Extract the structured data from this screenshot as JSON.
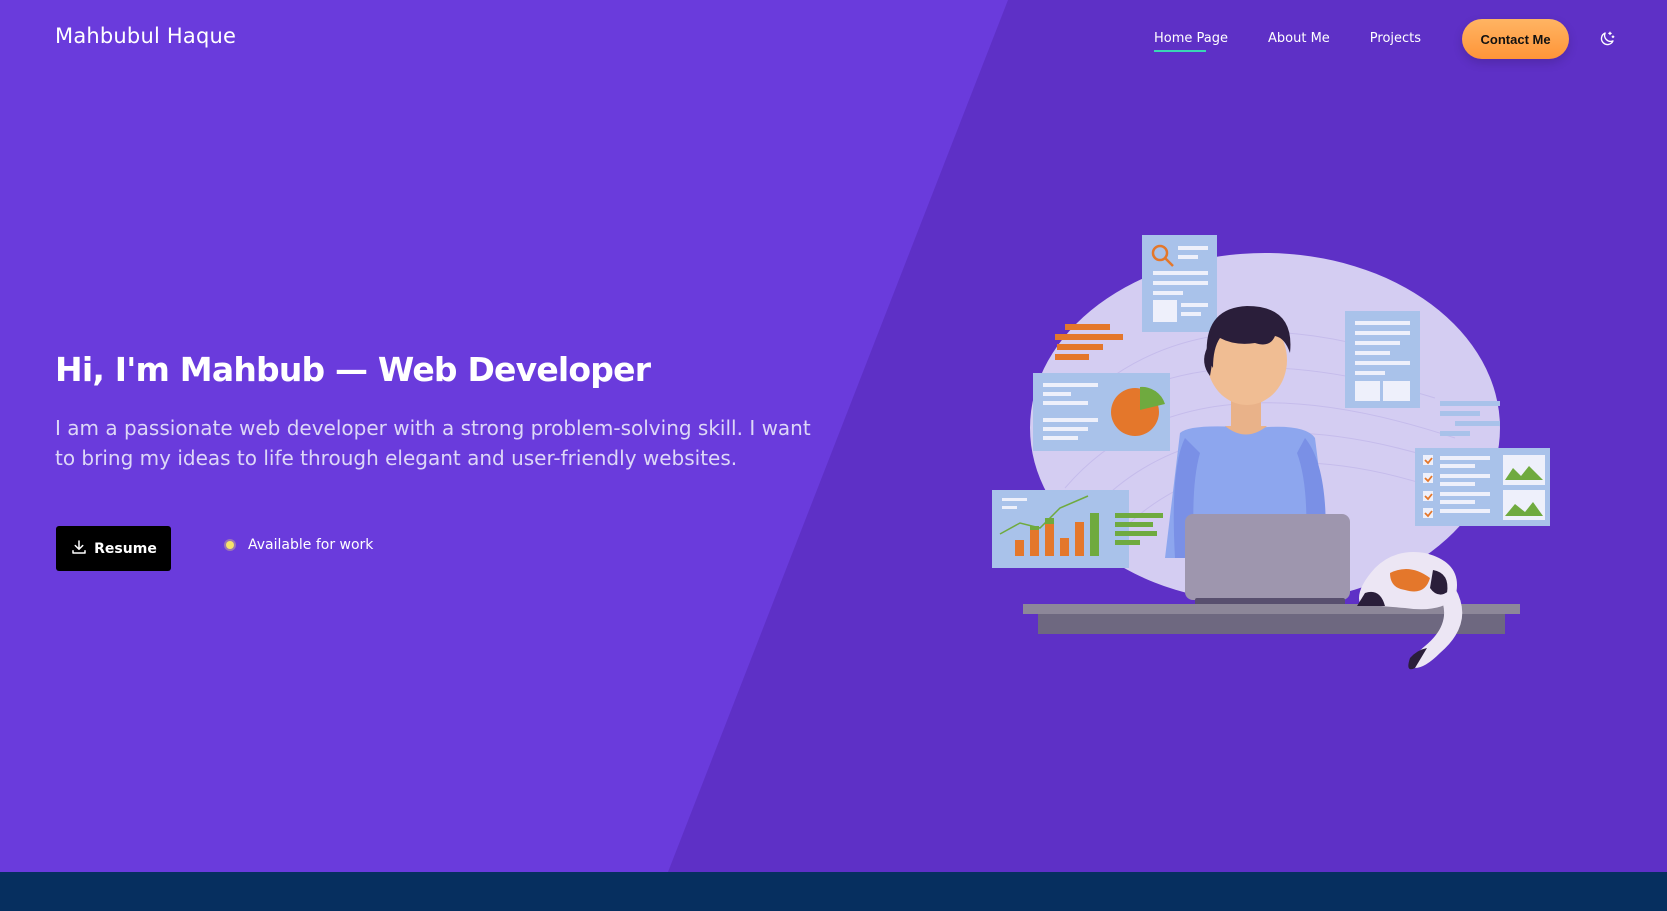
{
  "header": {
    "logo": "Mahbubul Haque",
    "nav": [
      {
        "label": "Home Page",
        "active": true
      },
      {
        "label": "About Me",
        "active": false
      },
      {
        "label": "Projects",
        "active": false
      }
    ],
    "contact_label": "Contact Me",
    "theme_icon": "moon-stars-icon"
  },
  "hero": {
    "headline": "Hi, I'm Mahbub — Web Developer",
    "intro": "I am a passionate web developer with a strong problem-solving skill. I want to bring my ideas to life through elegant and user-friendly websites.",
    "resume_label": "Resume",
    "resume_icon": "download-icon",
    "status_text": "Available for work",
    "illustration": "developer-at-laptop-illustration"
  },
  "colors": {
    "hero_bg": "#6a3bdc",
    "hero_bg_right": "#5e30c6",
    "footer_bg": "#062f5f",
    "accent_underline": "#3ad6b5",
    "contact_orange": "#ffa24d",
    "status_dot": "#f6e26a"
  }
}
